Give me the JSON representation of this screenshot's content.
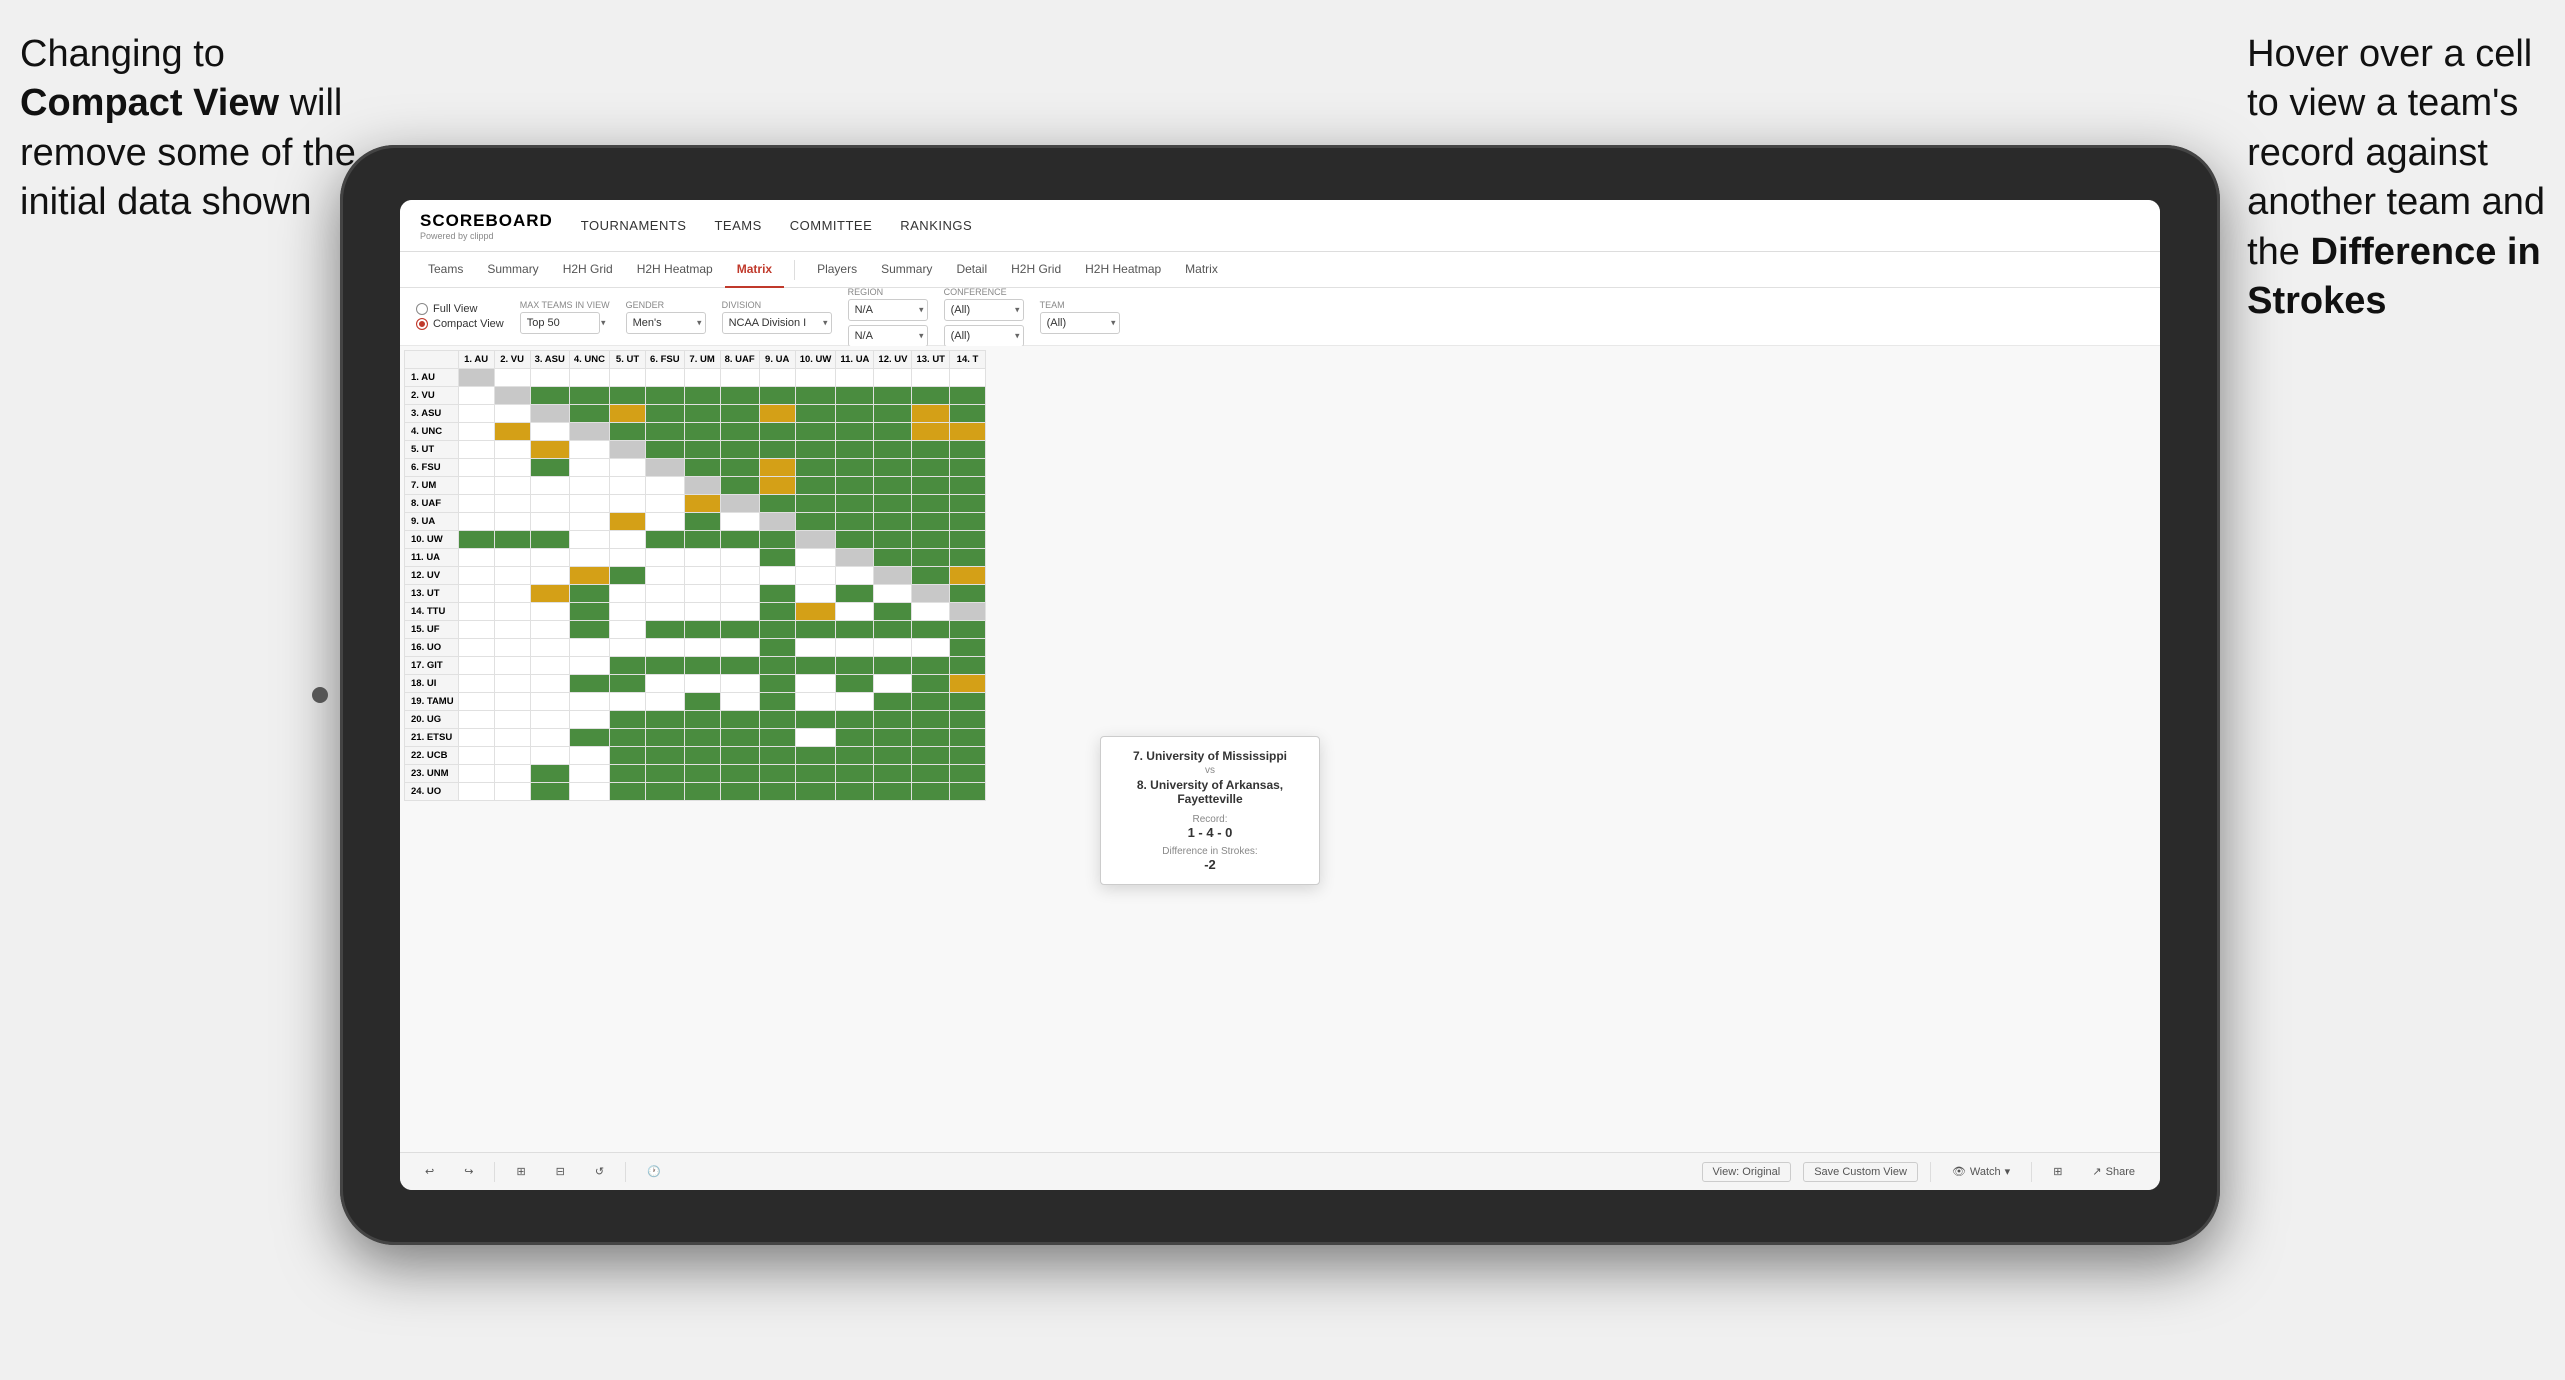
{
  "annotations": {
    "left_text_line1": "Changing to",
    "left_text_line2": "Compact View",
    "left_text_line3": " will",
    "left_text_line4": "remove some of the",
    "left_text_line5": "initial data shown",
    "right_text_line1": "Hover over a cell",
    "right_text_line2": "to view a team's",
    "right_text_line3": "record against",
    "right_text_line4": "another team and",
    "right_text_line5": "the ",
    "right_text_bold": "Difference in",
    "right_text_line6": "Strokes"
  },
  "nav": {
    "logo": "SCOREBOARD",
    "logo_sub": "Powered by clippd",
    "items": [
      "TOURNAMENTS",
      "TEAMS",
      "COMMITTEE",
      "RANKINGS"
    ]
  },
  "sub_nav": {
    "left_tabs": [
      "Teams",
      "Summary",
      "H2H Grid",
      "H2H Heatmap",
      "Matrix"
    ],
    "right_tabs": [
      "Players",
      "Summary",
      "Detail",
      "H2H Grid",
      "H2H Heatmap",
      "Matrix"
    ],
    "active": "Matrix"
  },
  "filters": {
    "view_options": [
      "Full View",
      "Compact View"
    ],
    "selected_view": "Compact View",
    "max_teams_label": "Max teams in view",
    "max_teams_value": "Top 50",
    "gender_label": "Gender",
    "gender_value": "Men's",
    "division_label": "Division",
    "division_value": "NCAA Division I",
    "region_label": "Region",
    "region_value": "N/A",
    "region_value2": "N/A",
    "conference_label": "Conference",
    "conference_value": "(All)",
    "conference_value2": "(All)",
    "team_label": "Team",
    "team_value": "(All)"
  },
  "matrix": {
    "col_headers": [
      "1. AU",
      "2. VU",
      "3. ASU",
      "4. UNC",
      "5. UT",
      "6. FSU",
      "7. UM",
      "8. UAF",
      "9. UA",
      "10. UW",
      "11. UA",
      "12. UV",
      "13. UT",
      "14. T"
    ],
    "rows": [
      {
        "label": "1. AU",
        "cells": [
          "x",
          "g",
          "g",
          "g",
          "g",
          "g",
          "g",
          "g",
          "g",
          "g",
          "g",
          "g",
          "g",
          "g"
        ]
      },
      {
        "label": "2. VU",
        "cells": [
          "w",
          "x",
          "g",
          "g",
          "g",
          "g",
          "g",
          "g",
          "g",
          "g",
          "g",
          "g",
          "g",
          "g"
        ]
      },
      {
        "label": "3. ASU",
        "cells": [
          "w",
          "w",
          "x",
          "g",
          "y",
          "g",
          "g",
          "g",
          "g",
          "g",
          "g",
          "g",
          "y",
          "g"
        ]
      },
      {
        "label": "4. UNC",
        "cells": [
          "w",
          "y",
          "w",
          "x",
          "g",
          "g",
          "g",
          "g",
          "g",
          "g",
          "g",
          "g",
          "y",
          "y"
        ]
      },
      {
        "label": "5. UT",
        "cells": [
          "w",
          "w",
          "y",
          "w",
          "x",
          "g",
          "g",
          "g",
          "g",
          "g",
          "g",
          "g",
          "g",
          "g"
        ]
      },
      {
        "label": "6. FSU",
        "cells": [
          "w",
          "w",
          "g",
          "w",
          "w",
          "x",
          "g",
          "g",
          "y",
          "g",
          "g",
          "g",
          "g",
          "g"
        ]
      },
      {
        "label": "7. UM",
        "cells": [
          "w",
          "w",
          "w",
          "w",
          "w",
          "w",
          "x",
          "g",
          "y",
          "g",
          "g",
          "g",
          "g",
          "g"
        ]
      },
      {
        "label": "8. UAF",
        "cells": [
          "w",
          "w",
          "w",
          "w",
          "w",
          "w",
          "y",
          "x",
          "g",
          "g",
          "g",
          "g",
          "g",
          "g"
        ]
      },
      {
        "label": "9. UA",
        "cells": [
          "w",
          "w",
          "w",
          "w",
          "y",
          "w",
          "g",
          "w",
          "x",
          "g",
          "g",
          "g",
          "g",
          "g"
        ]
      },
      {
        "label": "10. UW",
        "cells": [
          "g",
          "g",
          "g",
          "w",
          "w",
          "g",
          "g",
          "g",
          "g",
          "x",
          "g",
          "g",
          "g",
          "g"
        ]
      },
      {
        "label": "11. UA",
        "cells": [
          "w",
          "w",
          "w",
          "w",
          "w",
          "w",
          "w",
          "w",
          "g",
          "w",
          "x",
          "g",
          "g",
          "g"
        ]
      },
      {
        "label": "12. UV",
        "cells": [
          "w",
          "w",
          "w",
          "y",
          "g",
          "w",
          "w",
          "w",
          "w",
          "w",
          "w",
          "x",
          "g",
          "y"
        ]
      },
      {
        "label": "13. UT",
        "cells": [
          "w",
          "w",
          "y",
          "g",
          "w",
          "w",
          "w",
          "w",
          "g",
          "w",
          "g",
          "w",
          "x",
          "g"
        ]
      },
      {
        "label": "14. TTU",
        "cells": [
          "w",
          "w",
          "w",
          "g",
          "w",
          "w",
          "w",
          "w",
          "g",
          "y",
          "w",
          "g",
          "w",
          "x"
        ]
      },
      {
        "label": "15. UF",
        "cells": [
          "w",
          "w",
          "w",
          "g",
          "w",
          "g",
          "g",
          "g",
          "g",
          "g",
          "g",
          "g",
          "g",
          "g"
        ]
      },
      {
        "label": "16. UO",
        "cells": [
          "w",
          "w",
          "w",
          "w",
          "w",
          "w",
          "w",
          "w",
          "g",
          "w",
          "w",
          "w",
          "w",
          "g"
        ]
      },
      {
        "label": "17. GIT",
        "cells": [
          "w",
          "w",
          "w",
          "w",
          "g",
          "g",
          "g",
          "g",
          "g",
          "g",
          "g",
          "g",
          "g",
          "g"
        ]
      },
      {
        "label": "18. UI",
        "cells": [
          "w",
          "w",
          "w",
          "g",
          "g",
          "w",
          "w",
          "w",
          "g",
          "w",
          "g",
          "w",
          "g",
          "y"
        ]
      },
      {
        "label": "19. TAMU",
        "cells": [
          "w",
          "w",
          "w",
          "w",
          "w",
          "w",
          "g",
          "w",
          "g",
          "w",
          "w",
          "g",
          "g",
          "g"
        ]
      },
      {
        "label": "20. UG",
        "cells": [
          "w",
          "w",
          "w",
          "w",
          "g",
          "g",
          "g",
          "g",
          "g",
          "g",
          "g",
          "g",
          "g",
          "g"
        ]
      },
      {
        "label": "21. ETSU",
        "cells": [
          "w",
          "w",
          "w",
          "g",
          "g",
          "g",
          "g",
          "g",
          "g",
          "w",
          "g",
          "g",
          "g",
          "g"
        ]
      },
      {
        "label": "22. UCB",
        "cells": [
          "w",
          "w",
          "w",
          "w",
          "g",
          "g",
          "g",
          "g",
          "g",
          "g",
          "g",
          "g",
          "g",
          "g"
        ]
      },
      {
        "label": "23. UNM",
        "cells": [
          "w",
          "w",
          "g",
          "w",
          "g",
          "g",
          "g",
          "g",
          "g",
          "g",
          "g",
          "g",
          "g",
          "g"
        ]
      },
      {
        "label": "24. UO",
        "cells": [
          "w",
          "w",
          "g",
          "w",
          "g",
          "g",
          "g",
          "g",
          "g",
          "g",
          "g",
          "g",
          "g",
          "g"
        ]
      }
    ]
  },
  "tooltip": {
    "team1": "7. University of Mississippi",
    "vs": "vs",
    "team2": "8. University of Arkansas, Fayetteville",
    "record_label": "Record:",
    "record": "1 - 4 - 0",
    "strokes_label": "Difference in Strokes:",
    "strokes": "-2"
  },
  "toolbar": {
    "undo": "↩",
    "redo": "↪",
    "tools": [
      "⊞",
      "⊟",
      "↺"
    ],
    "view_original": "View: Original",
    "save_custom": "Save Custom View",
    "watch": "Watch",
    "share": "Share"
  }
}
